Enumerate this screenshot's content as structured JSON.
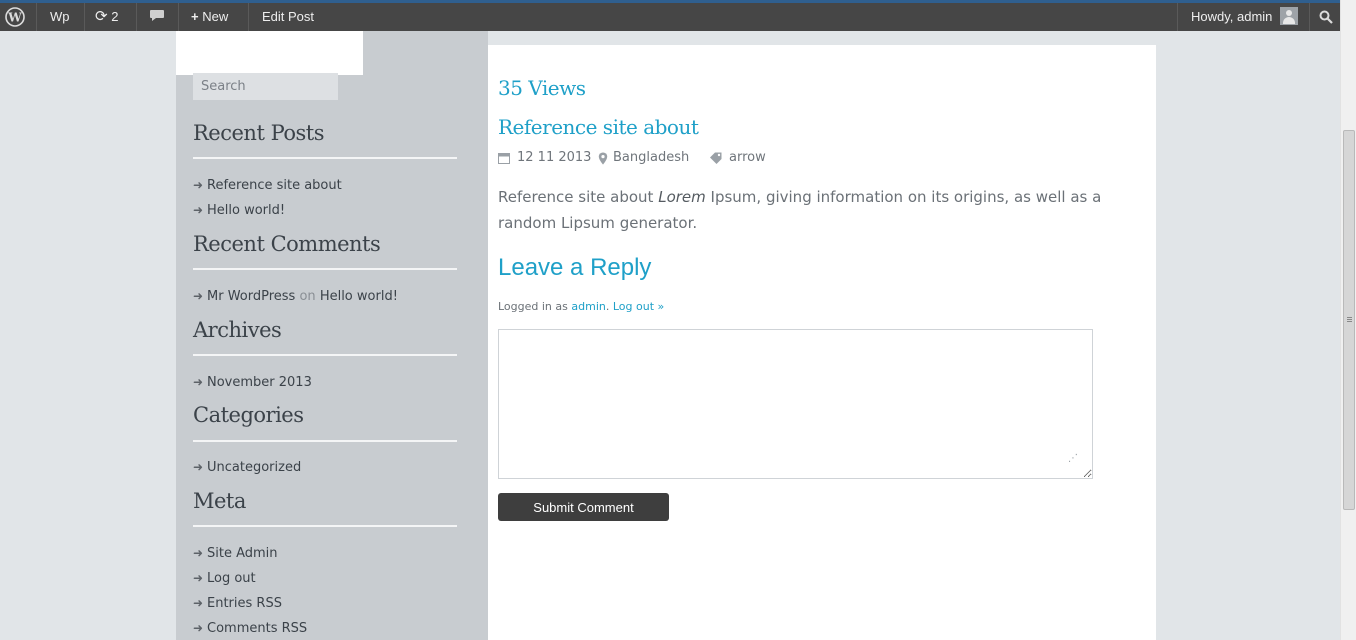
{
  "adminbar": {
    "wp_logo_icon": "wordpress-icon",
    "site_name": "Wp",
    "updates_count": "2",
    "new_label": "New",
    "edit_label": "Edit Post",
    "howdy": "Howdy, admin",
    "search_icon": "search-icon"
  },
  "sidebar": {
    "search_placeholder": "Search",
    "widgets": {
      "recent_posts": {
        "title": "Recent Posts",
        "items": [
          "Reference site about",
          "Hello world!"
        ]
      },
      "recent_comments": {
        "title": "Recent Comments",
        "author": "Mr WordPress",
        "on": "on",
        "post": "Hello world!"
      },
      "archives": {
        "title": "Archives",
        "items": [
          "November 2013"
        ]
      },
      "categories": {
        "title": "Categories",
        "items": [
          "Uncategorized"
        ]
      },
      "meta": {
        "title": "Meta",
        "items": [
          "Site Admin",
          "Log out",
          "Entries RSS",
          "Comments RSS"
        ]
      }
    }
  },
  "post": {
    "views": "35 Views",
    "title": "Reference site about",
    "date": "12 11 2013",
    "location": "Bangladesh",
    "tag": "arrow",
    "body_prefix": "Reference site about ",
    "body_em": "Lorem",
    "body_suffix": " Ipsum, giving information on its origins, as well as a random Lipsum generator."
  },
  "reply": {
    "title": "Leave a Reply",
    "logged_prefix": "Logged in as",
    "user": "admin",
    "logout": "Log out »",
    "submit_label": "Submit Comment"
  },
  "colors": {
    "accent": "#1fa0c8",
    "adminbar": "#464646",
    "sidebar": "#c8ccd0"
  }
}
